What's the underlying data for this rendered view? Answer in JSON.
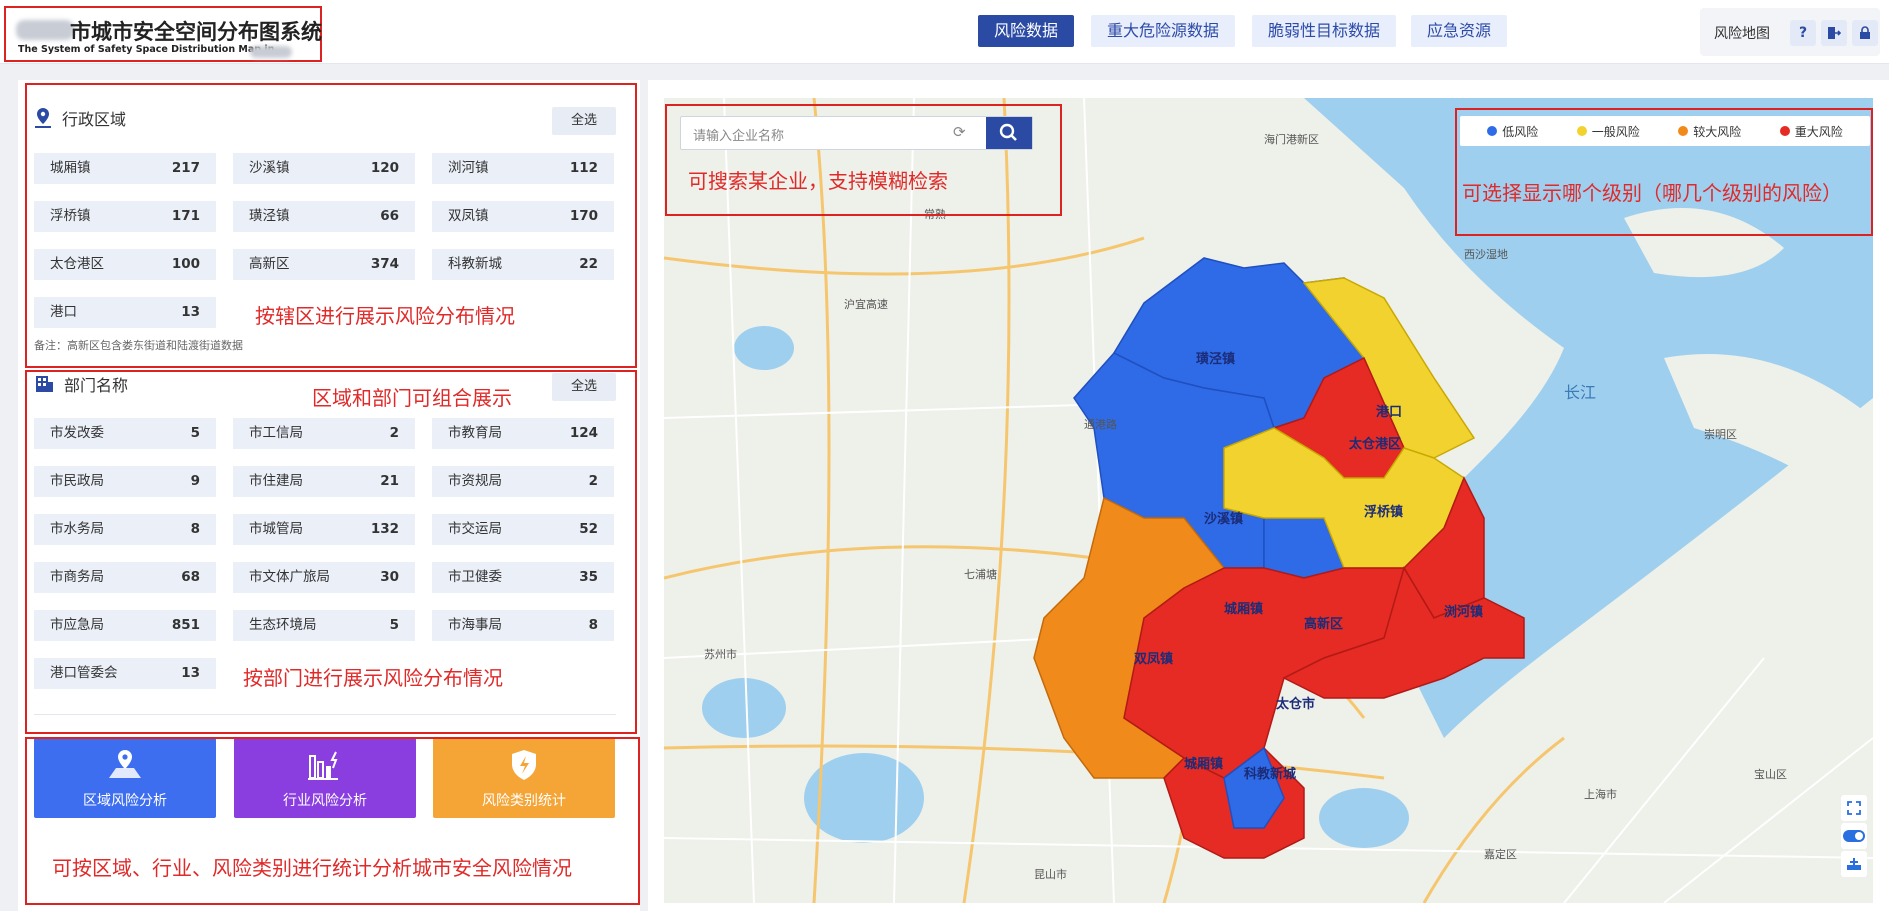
{
  "brand": {
    "title": "市城市安全空间分布图系统",
    "subtitle": "The System of Safety Space Distribution Map in"
  },
  "nav": {
    "tabs": [
      {
        "label": "风险数据",
        "active": true
      },
      {
        "label": "重大危险源数据",
        "active": false
      },
      {
        "label": "脆弱性目标数据",
        "active": false
      },
      {
        "label": "应急资源",
        "active": false
      }
    ]
  },
  "tools": {
    "map_label": "风险地图",
    "help": "?"
  },
  "region": {
    "title": "行政区域",
    "select_all": "全选",
    "items": [
      {
        "name": "城厢镇",
        "count": "217"
      },
      {
        "name": "沙溪镇",
        "count": "120"
      },
      {
        "name": "浏河镇",
        "count": "112"
      },
      {
        "name": "浮桥镇",
        "count": "171"
      },
      {
        "name": "璜泾镇",
        "count": "66"
      },
      {
        "name": "双凤镇",
        "count": "170"
      },
      {
        "name": "太仓港区",
        "count": "100"
      },
      {
        "name": "高新区",
        "count": "374"
      },
      {
        "name": "科教新城",
        "count": "22"
      },
      {
        "name": "港口",
        "count": "13"
      }
    ],
    "note": "备注：高新区包含娄东街道和陆渡街道数据"
  },
  "dept": {
    "title": "部门名称",
    "select_all": "全选",
    "items": [
      {
        "name": "市发改委",
        "count": "5"
      },
      {
        "name": "市工信局",
        "count": "2"
      },
      {
        "name": "市教育局",
        "count": "124"
      },
      {
        "name": "市民政局",
        "count": "9"
      },
      {
        "name": "市住建局",
        "count": "21"
      },
      {
        "name": "市资规局",
        "count": "2"
      },
      {
        "name": "市水务局",
        "count": "8"
      },
      {
        "name": "市城管局",
        "count": "132"
      },
      {
        "name": "市交运局",
        "count": "52"
      },
      {
        "name": "市商务局",
        "count": "68"
      },
      {
        "name": "市文体广旅局",
        "count": "30"
      },
      {
        "name": "市卫健委",
        "count": "35"
      },
      {
        "name": "市应急局",
        "count": "851"
      },
      {
        "name": "生态环境局",
        "count": "5"
      },
      {
        "name": "市海事局",
        "count": "8"
      },
      {
        "name": "港口管委会",
        "count": "13"
      }
    ]
  },
  "analysis": {
    "buttons": [
      {
        "label": "区域风险分析",
        "color": "#3d6ef0"
      },
      {
        "label": "行业风险分析",
        "color": "#8a3ee0"
      },
      {
        "label": "风险类别统计",
        "color": "#f5a436"
      }
    ]
  },
  "search": {
    "placeholder": "请输入企业名称"
  },
  "legend": {
    "items": [
      {
        "label": "低风险",
        "color": "#2f6be6"
      },
      {
        "label": "一般风险",
        "color": "#f2d22e"
      },
      {
        "label": "较大风险",
        "color": "#f08a1a"
      },
      {
        "label": "重大风险",
        "color": "#e62a24"
      }
    ]
  },
  "annotations": {
    "region": "按辖区进行展示风险分布情况",
    "combine": "区域和部门可组合展示",
    "dept": "按部门进行展示风险分布情况",
    "analysis": "可按区域、行业、风险类别进行统计分析城市安全风险情况",
    "search": "可搜索某企业，支持模糊检索",
    "legend": "可选择显示哪个级别（哪几个级别的风险）"
  },
  "map": {
    "river_labels": [
      "长江"
    ],
    "town_labels": [
      "璜泾镇",
      "港口",
      "太仓港区",
      "沙溪镇",
      "浮桥镇",
      "城厢镇",
      "浏河镇",
      "高新区",
      "双凤镇",
      "太仓市",
      "城厢镇",
      "科教新城"
    ],
    "place_labels": [
      "海门港新区",
      "西沙湿地",
      "常熟",
      "沪宜高速",
      "苏州市",
      "昆山市",
      "上海市",
      "宝山区",
      "嘉定区",
      "崇明区",
      "通港路",
      "七浦塘"
    ]
  }
}
